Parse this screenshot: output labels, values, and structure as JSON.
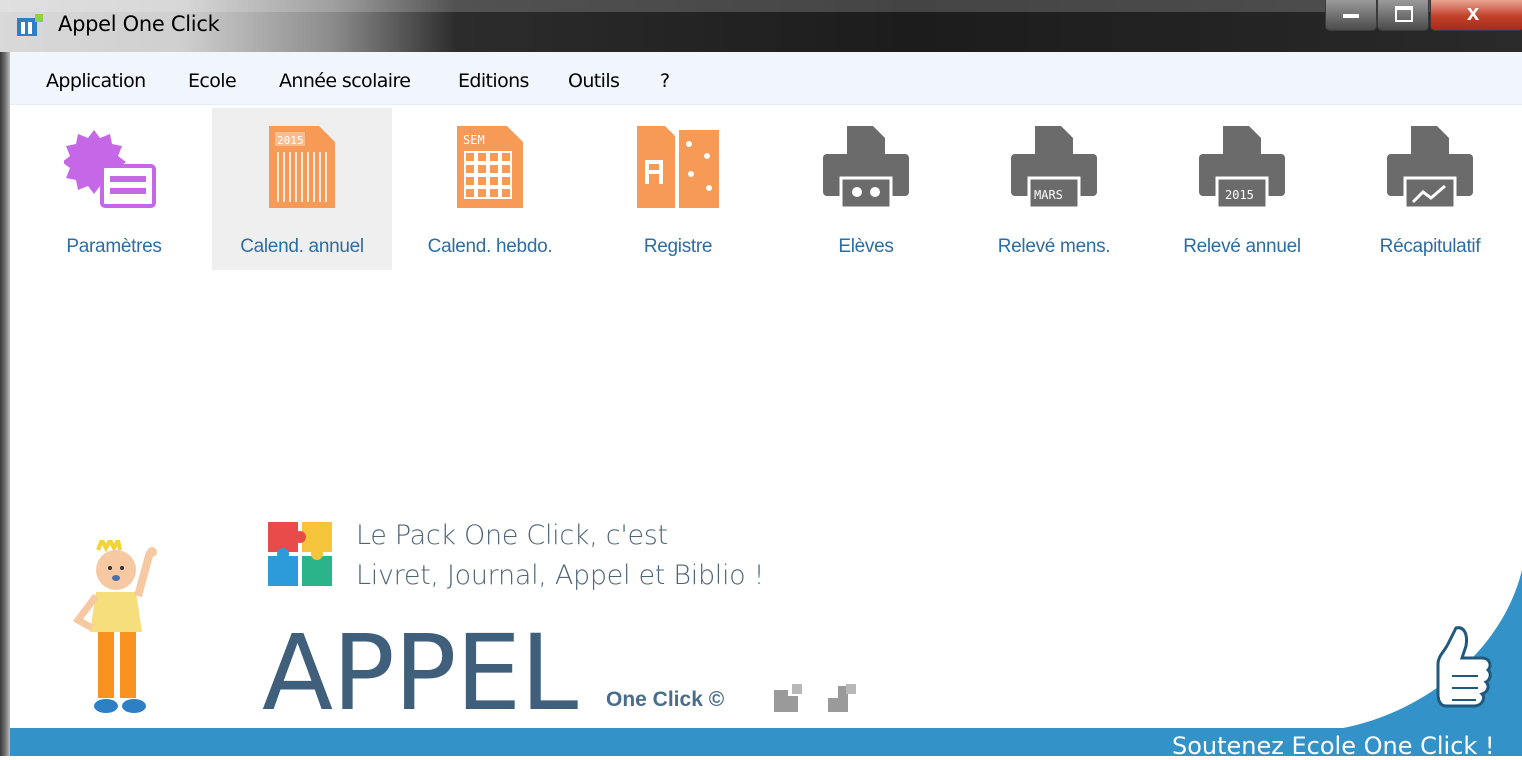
{
  "window": {
    "title": "Appel One Click"
  },
  "menu": [
    "Application",
    "Ecole",
    "Année scolaire",
    "Editions",
    "Outils",
    "?"
  ],
  "toolbar": [
    {
      "label": "Paramètres",
      "icon": "settings-icon"
    },
    {
      "label": "Calend. annuel",
      "icon": "annual-calendar-icon",
      "badge": "2015",
      "selected": true
    },
    {
      "label": "Calend. hebdo.",
      "icon": "weekly-calendar-icon",
      "badge": "SEM"
    },
    {
      "label": "Registre",
      "icon": "register-icon"
    },
    {
      "label": "Elèves",
      "icon": "students-printer-icon"
    },
    {
      "label": "Relevé mens.",
      "icon": "monthly-report-printer-icon",
      "badge": "MARS"
    },
    {
      "label": "Relevé annuel",
      "icon": "annual-report-printer-icon",
      "badge": "2015"
    },
    {
      "label": "Récapitulatif",
      "icon": "summary-printer-icon"
    }
  ],
  "promo": {
    "line1": "Le Pack One Click, c'est",
    "line2": "Livret, Journal, Appel et Biblio !",
    "product": "APPEL",
    "brand": "One Click ©",
    "support": "Soutenez Ecole One Click !"
  },
  "colors": {
    "accent": "#3392c7",
    "label": "#2e6da4",
    "orange": "#f79a55",
    "purple": "#c667e8",
    "printer": "#6b6b6b"
  }
}
